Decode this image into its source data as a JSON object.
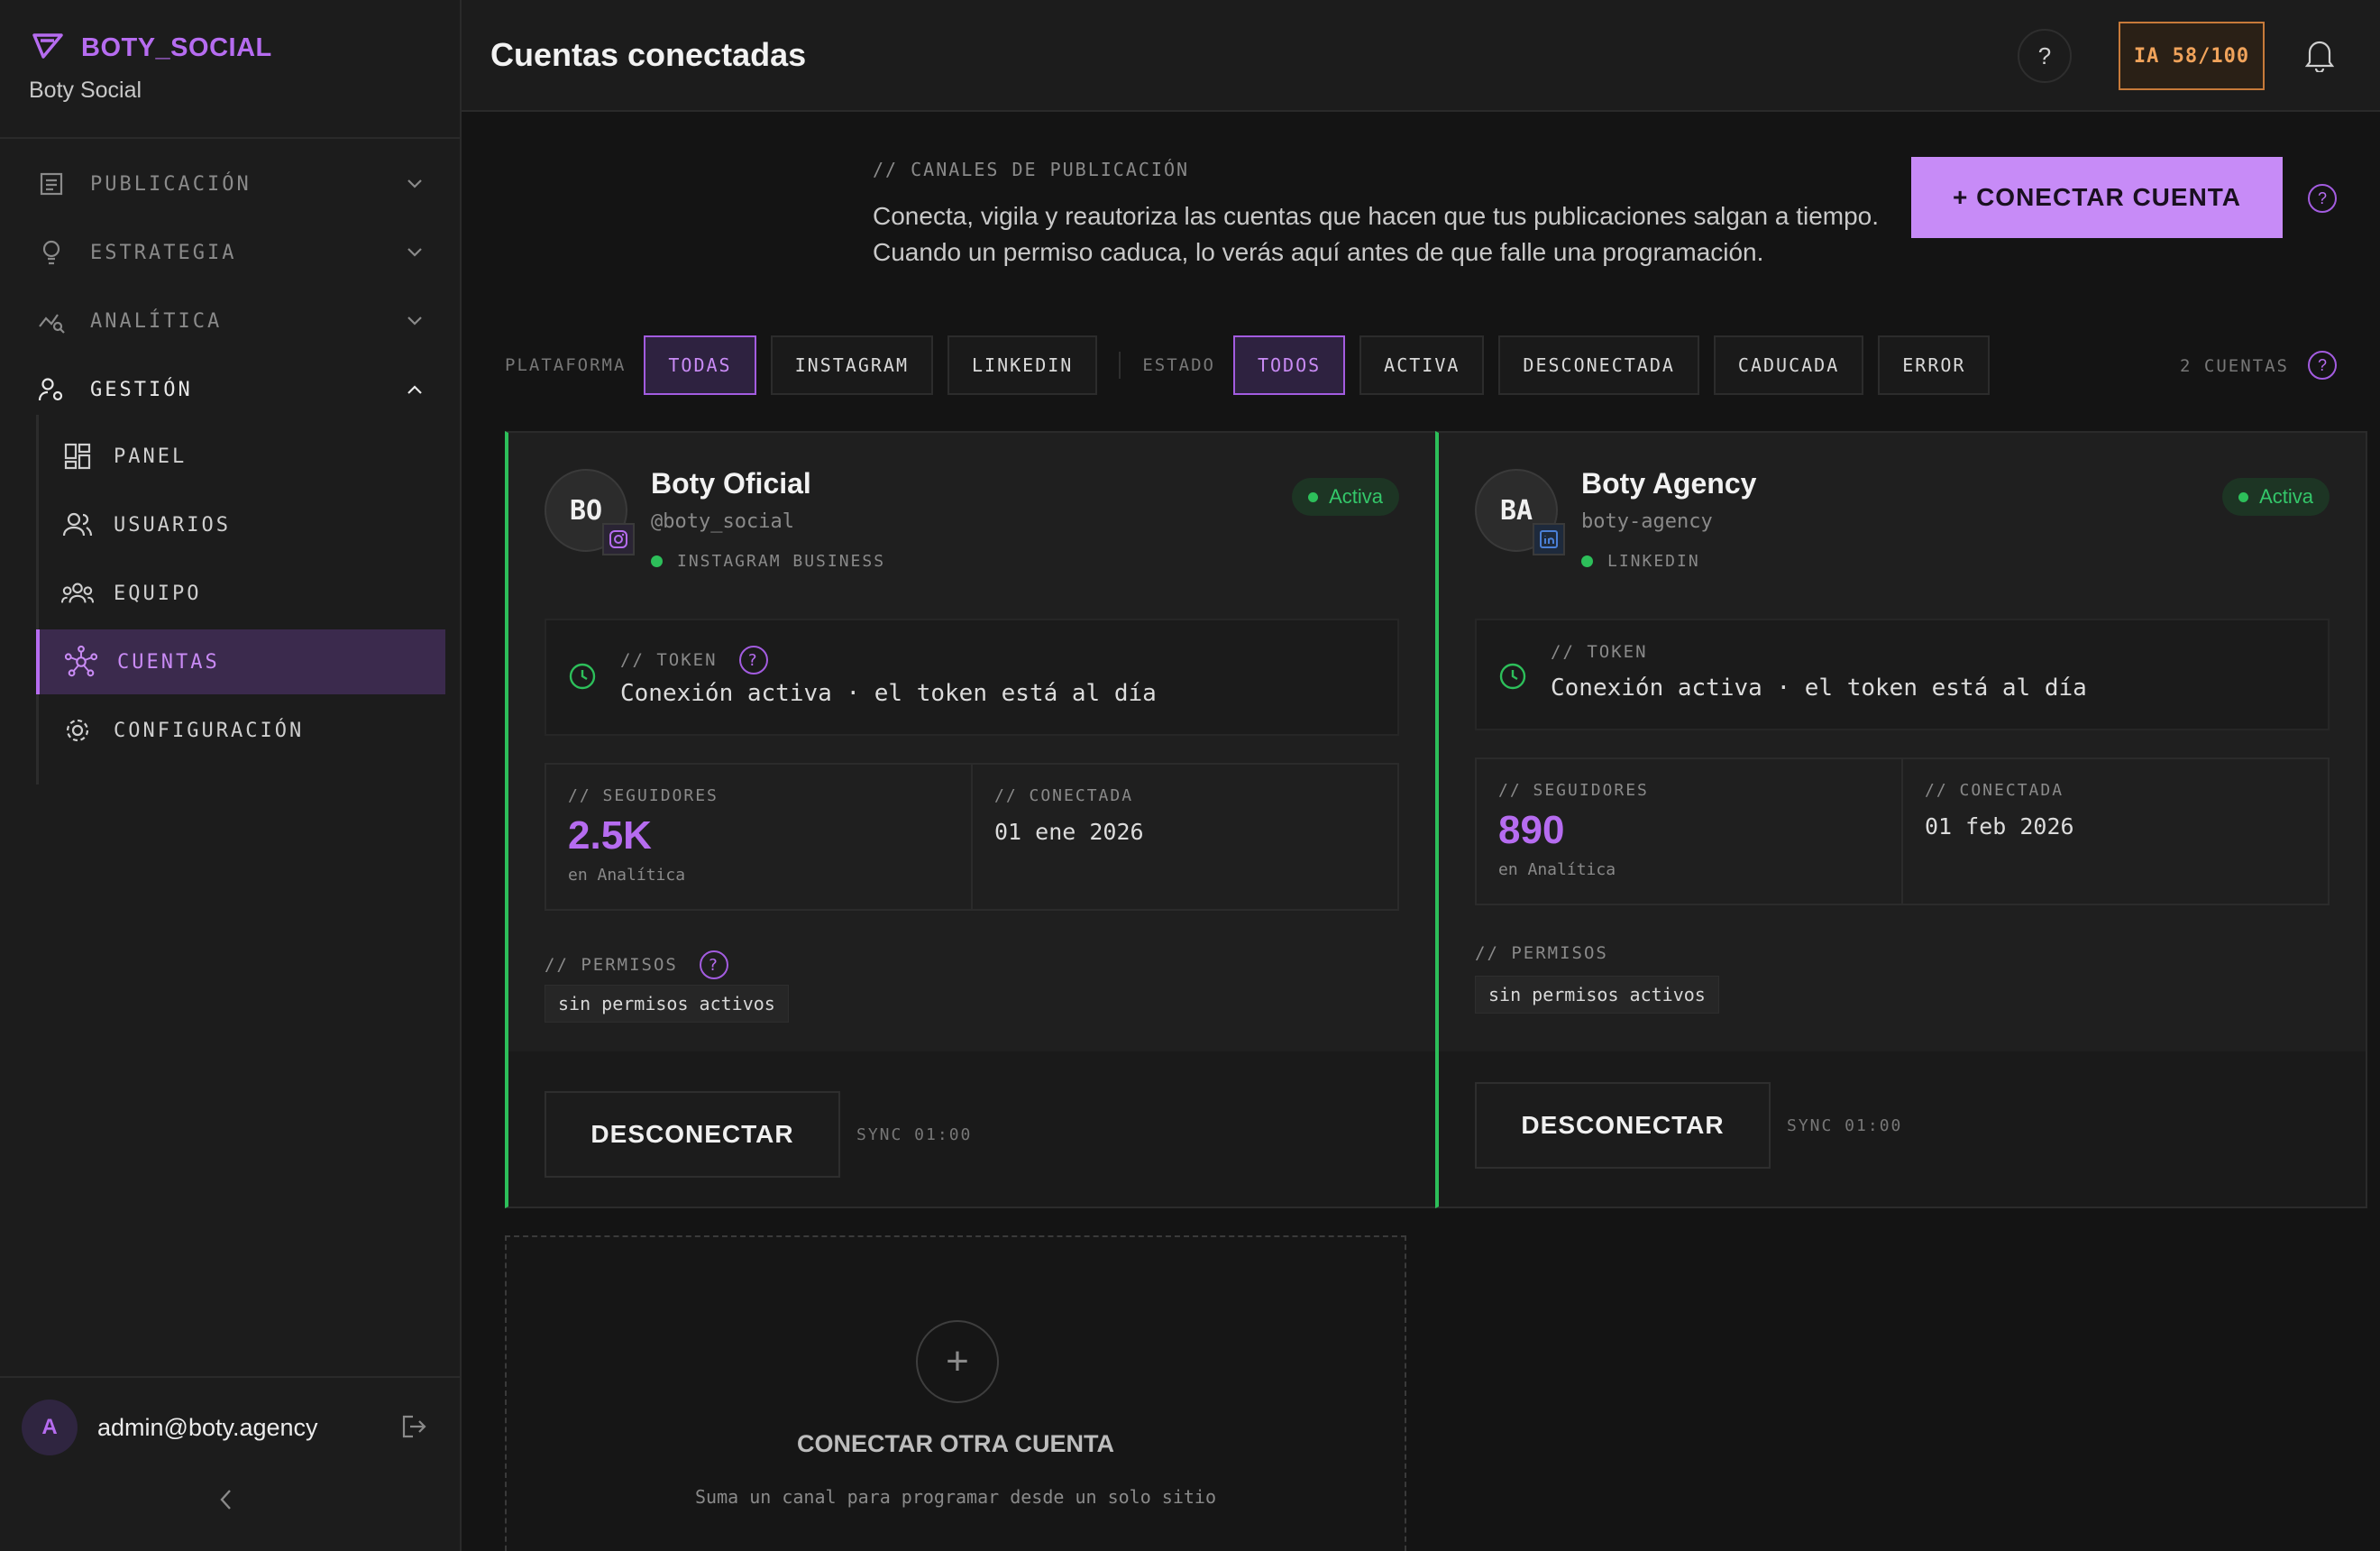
{
  "brand": {
    "name": "BOTY_SOCIAL",
    "subtitle": "Boty Social"
  },
  "sidebar": {
    "sections": [
      {
        "label": "PUBLICACIÓN",
        "icon": "document-icon",
        "expanded": false
      },
      {
        "label": "ESTRATEGIA",
        "icon": "lightbulb-icon",
        "expanded": false
      },
      {
        "label": "ANALÍTICA",
        "icon": "analytics-icon",
        "expanded": false
      },
      {
        "label": "GESTIÓN",
        "icon": "user-gear-icon",
        "expanded": true
      }
    ],
    "items": [
      {
        "label": "PANEL",
        "icon": "dashboard-icon",
        "active": false
      },
      {
        "label": "USUARIOS",
        "icon": "users-icon",
        "active": false
      },
      {
        "label": "EQUIPO",
        "icon": "team-icon",
        "active": false
      },
      {
        "label": "CUENTAS",
        "icon": "network-icon",
        "active": true
      },
      {
        "label": "CONFIGURACIÓN",
        "icon": "gear-icon",
        "active": false
      }
    ],
    "user": {
      "initial": "A",
      "email": "admin@boty.agency"
    }
  },
  "header": {
    "title": "Cuentas conectadas",
    "help": "?",
    "ia_quota": "IA 58/100"
  },
  "intro": {
    "label": "// CANALES DE PUBLICACIÓN",
    "text": "Conecta, vigila y reautoriza las cuentas que hacen que tus publicaciones salgan a tiempo. Cuando un permiso caduca, lo verás aquí antes de que falle una programación.",
    "cta": "+ CONECTAR CUENTA"
  },
  "filters": {
    "platform_label": "PLATAFORMA",
    "platform_options": [
      "TODAS",
      "INSTAGRAM",
      "LINKEDIN"
    ],
    "platform_selected": "TODAS",
    "status_label": "ESTADO",
    "status_options": [
      "TODOS",
      "ACTIVA",
      "DESCONECTADA",
      "CADUCADA",
      "ERROR"
    ],
    "status_selected": "TODOS",
    "count": "2 CUENTAS"
  },
  "accounts": [
    {
      "initials": "BO",
      "name": "Boty Oficial",
      "handle": "@boty_social",
      "platform": "INSTAGRAM BUSINESS",
      "platform_icon": "instagram-icon",
      "status": "Activa",
      "token_label": "// TOKEN",
      "token_text": "Conexión activa · el token está al día",
      "followers_label": "// SEGUIDORES",
      "followers": "2.5K",
      "followers_sub": "en Analítica",
      "connected_label": "// CONECTADA",
      "connected": "01 ene 2026",
      "perms_label": "// PERMISOS",
      "perms": "sin permisos activos",
      "disconnect": "DESCONECTAR",
      "sync": "SYNC 01:00"
    },
    {
      "initials": "BA",
      "name": "Boty Agency",
      "handle": "boty-agency",
      "platform": "LINKEDIN",
      "platform_icon": "linkedin-icon",
      "status": "Activa",
      "token_label": "// TOKEN",
      "token_text": "Conexión activa · el token está al día",
      "followers_label": "// SEGUIDORES",
      "followers": "890",
      "followers_sub": "en Analítica",
      "connected_label": "// CONECTADA",
      "connected": "01 feb 2026",
      "perms_label": "// PERMISOS",
      "perms": "sin permisos activos",
      "disconnect": "DESCONECTAR",
      "sync": "SYNC 01:00"
    }
  ],
  "add_account": {
    "plus": "+",
    "title": "CONECTAR OTRA CUENTA",
    "subtitle": "Suma un canal para programar desde un solo sitio"
  },
  "colors": {
    "accent": "#b66cf0",
    "cta": "#c78bf7",
    "active_green": "#2dbf5a",
    "ia_orange": "#f0a35b"
  }
}
